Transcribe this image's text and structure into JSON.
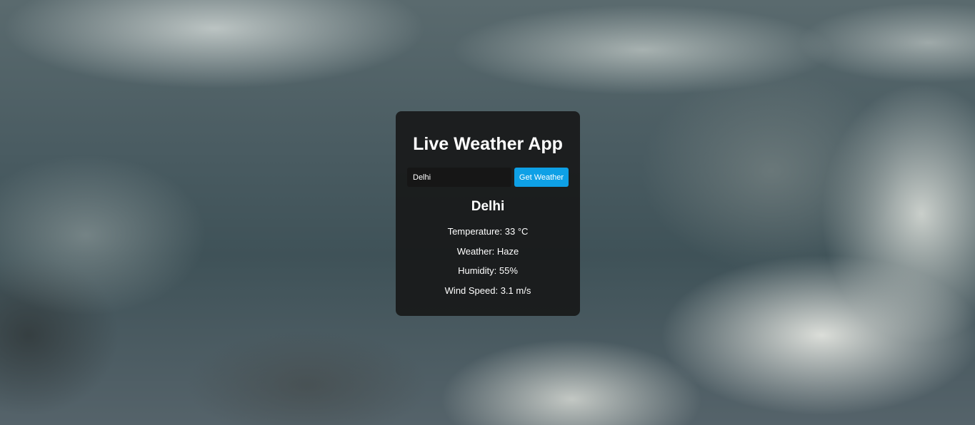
{
  "app": {
    "title": "Live Weather App"
  },
  "search": {
    "value": "Delhi",
    "button_label": "Get Weather"
  },
  "result": {
    "city": "Delhi",
    "temperature": "Temperature: 33 °C",
    "weather": "Weather: Haze",
    "humidity": "Humidity: 55%",
    "wind": "Wind Speed: 3.1 m/s"
  },
  "colors": {
    "accent": "#0ea0e6",
    "card_background": "#161616"
  }
}
